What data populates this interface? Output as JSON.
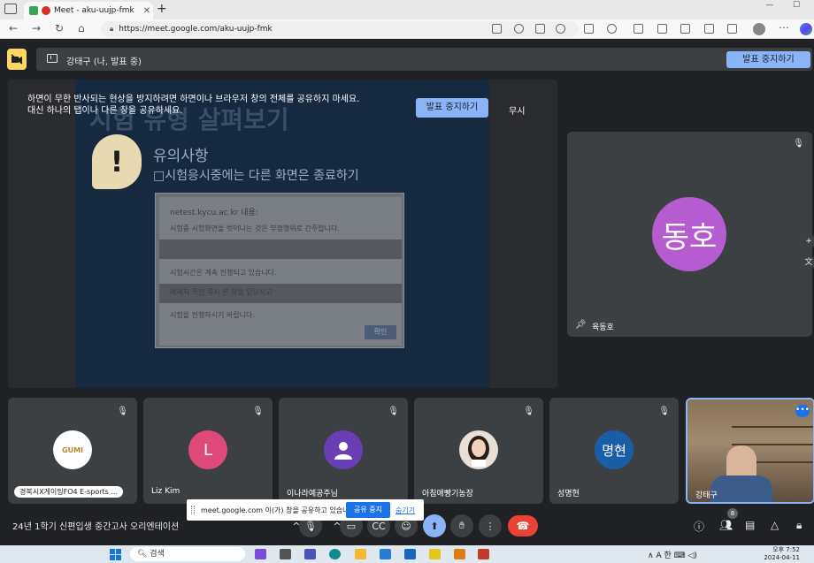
{
  "browser": {
    "tab_title": "Meet - aku-uujp-fmk",
    "url": "https://meet.google.com/aku-uujp-fmk",
    "new_tab": "+",
    "tab_close": "✕",
    "window_minimize": "—",
    "window_maximize": "☐"
  },
  "top_bar": {
    "presenter_label": "강태구 (나, 발표 중)",
    "stop_presenting": "발표 중지하기"
  },
  "presentation": {
    "notice_line1": "하면이 무한 반사되는 현상을 방지하려면 하면이나 브라우저 창의 전체를 공유하지 마세요.",
    "notice_line2": "대신 하나의 탭이나 다른 창을 공유하세요.",
    "stop_presenting": "발표 중지하기",
    "ignore": "무시",
    "slide_heading": "시험 유형 살펴보기",
    "slide_sub": "유의사항",
    "slide_line": "□시험응시중에는 다른 화면은 종료하기",
    "dialog": {
      "origin": "netest.kycu.ac.kr 내용:",
      "line1": "시험중 시험화면을 벗어나는 것은 부정행위로 간주합니다.",
      "line2": "시험시간은 계속 진행되고 있습니다.",
      "line3": "메세지 확인 즉시 본 창을 닫으시고",
      "line4": "시험을 진행하시기 바랍니다.",
      "ok": "확인"
    }
  },
  "side_tile": {
    "initials": "동호",
    "name": "육동호",
    "avatar_color": "#b55cd0"
  },
  "participants": [
    {
      "name": "경북시X게이밍FO4 E-sports ...",
      "kind": "logo",
      "logo_text": "GUMI"
    },
    {
      "name": "Liz Kim",
      "initial": "L",
      "color": "#e04a7a"
    },
    {
      "name": "이나라예공주님",
      "kind": "generic",
      "color": "#6a3fb5"
    },
    {
      "name": "아침애빵기농장",
      "kind": "photo"
    },
    {
      "name": "성명현",
      "initial": "명현",
      "color": "#1a5ea8"
    },
    {
      "name": "강태구",
      "kind": "video",
      "more": "•••"
    }
  ],
  "bottom": {
    "meeting_title": "24년 1학기 신편입생 중간고사 오리엔테이션",
    "share_text": "meet.google.com 이(가) 창을 공유하고 있습니다.",
    "share_stop": "공유 중지",
    "share_hide": "숨기기",
    "people_count": "8"
  },
  "taskbar": {
    "search": "검색",
    "tray": "∧  A  한  ⌨ ◁)",
    "time": "오후 7:52",
    "date": "2024-04-11"
  }
}
